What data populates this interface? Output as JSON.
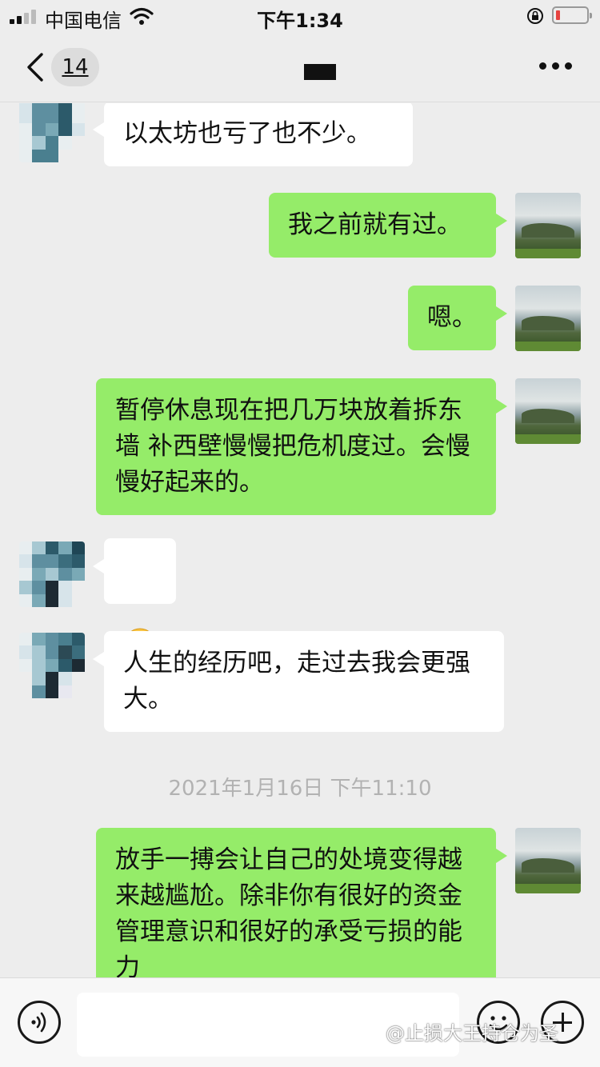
{
  "status_bar": {
    "carrier": "中国电信",
    "time": "下午1:34",
    "battery_level": 0.1,
    "icons": [
      "signal-icon",
      "wifi-icon",
      "orientation-lock-icon",
      "battery-icon"
    ]
  },
  "nav": {
    "back_icon": "chevron-left-icon",
    "unread_count": "14",
    "more_icon": "ellipsis-icon"
  },
  "messages": [
    {
      "side": "left",
      "text": "以太坊也亏了也不少。"
    },
    {
      "side": "right",
      "text": "我之前就有过。"
    },
    {
      "side": "right",
      "text": "嗯。"
    },
    {
      "side": "right",
      "text": "暂停休息现在把几万块放着拆东墙 补西壁慢慢把危机度过。会慢慢好起来的。"
    },
    {
      "side": "left",
      "text": "",
      "emoji": "frowning-face-emoji"
    },
    {
      "side": "left",
      "text": "人生的经历吧，走过去我会更强大。"
    },
    {
      "side": "right",
      "text": "放手一搏会让自己的处境变得越来越尴尬。除非你有很好的资金管理意识和很好的承受亏损的能力"
    }
  ],
  "timestamp": "2021年1月16日 下午11:10",
  "input_bar": {
    "voice_icon": "voice-icon",
    "input_value": "",
    "emoji_icon": "smiley-icon",
    "plus_icon": "plus-icon"
  },
  "watermark": "@止损大王持仓为圣",
  "colors": {
    "background": "#ededed",
    "my_bubble": "#95ec69",
    "their_bubble": "#ffffff",
    "timestamp_text": "#b2b2b2"
  }
}
